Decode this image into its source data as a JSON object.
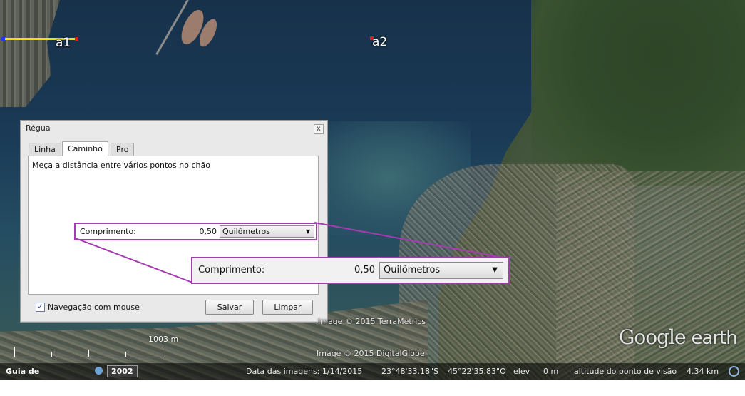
{
  "map": {
    "point_labels": [
      "a1",
      "a2"
    ],
    "attribution_terrametrics": "Image © 2015 TerraMetrics",
    "attribution_digitalglobe": "Image © 2015 DigitalGlobe",
    "scale_label": "1003 m",
    "logo_google": "Google",
    "logo_earth": "earth",
    "ruler_color": "#f5e100",
    "highlight_color": "#a53bb0"
  },
  "dialog": {
    "title": "Régua",
    "close_glyph": "x",
    "tabs": [
      "Linha",
      "Caminho",
      "Pro"
    ],
    "active_tab": "Caminho",
    "description": "Meça a distância entre vários pontos no chão",
    "length_label": "Comprimento:",
    "length_value": "0,50",
    "unit_selected": "Quilômetros",
    "mouse_nav_label": "Navegação com mouse",
    "mouse_nav_checked": true,
    "save_label": "Salvar",
    "clear_label": "Limpar"
  },
  "zoom": {
    "length_label": "Comprimento:",
    "length_value": "0,50",
    "unit_selected": "Quilômetros"
  },
  "statusbar": {
    "tour_label": "Guia de turismo",
    "year": "2002",
    "imagery_date": "Data das imagens: 1/14/2015",
    "latitude": "23°48'33.18\"S",
    "longitude": "45°22'35.83\"O",
    "elev_label": "elev",
    "elev_value": "0 m",
    "eye_alt_label": "altitude do ponto de visão",
    "eye_alt_value": "4.34 km"
  }
}
